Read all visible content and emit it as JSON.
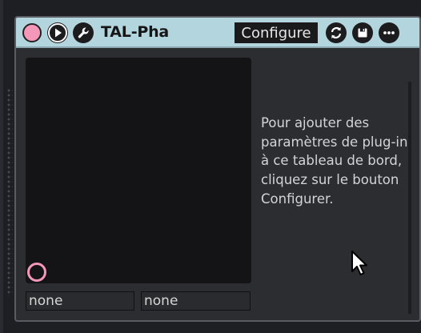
{
  "device": {
    "title": "TAL-Pha",
    "configure_label": "Configure",
    "power_color": "#f497b8",
    "titlebar_color": "#b3d6de",
    "icons": {
      "power": "power-toggle-icon",
      "play": "play-icon",
      "wrench": "wrench-icon",
      "refresh": "refresh-icon",
      "save": "save-icon",
      "more": "more-icon"
    }
  },
  "xy_pad": {
    "x_param": "none",
    "y_param": "none",
    "handle_color": "#f497b8"
  },
  "info_text": "Pour ajouter des paramètres de plug-in à ce tableau de bord, cliquez sur le bouton Configurer."
}
